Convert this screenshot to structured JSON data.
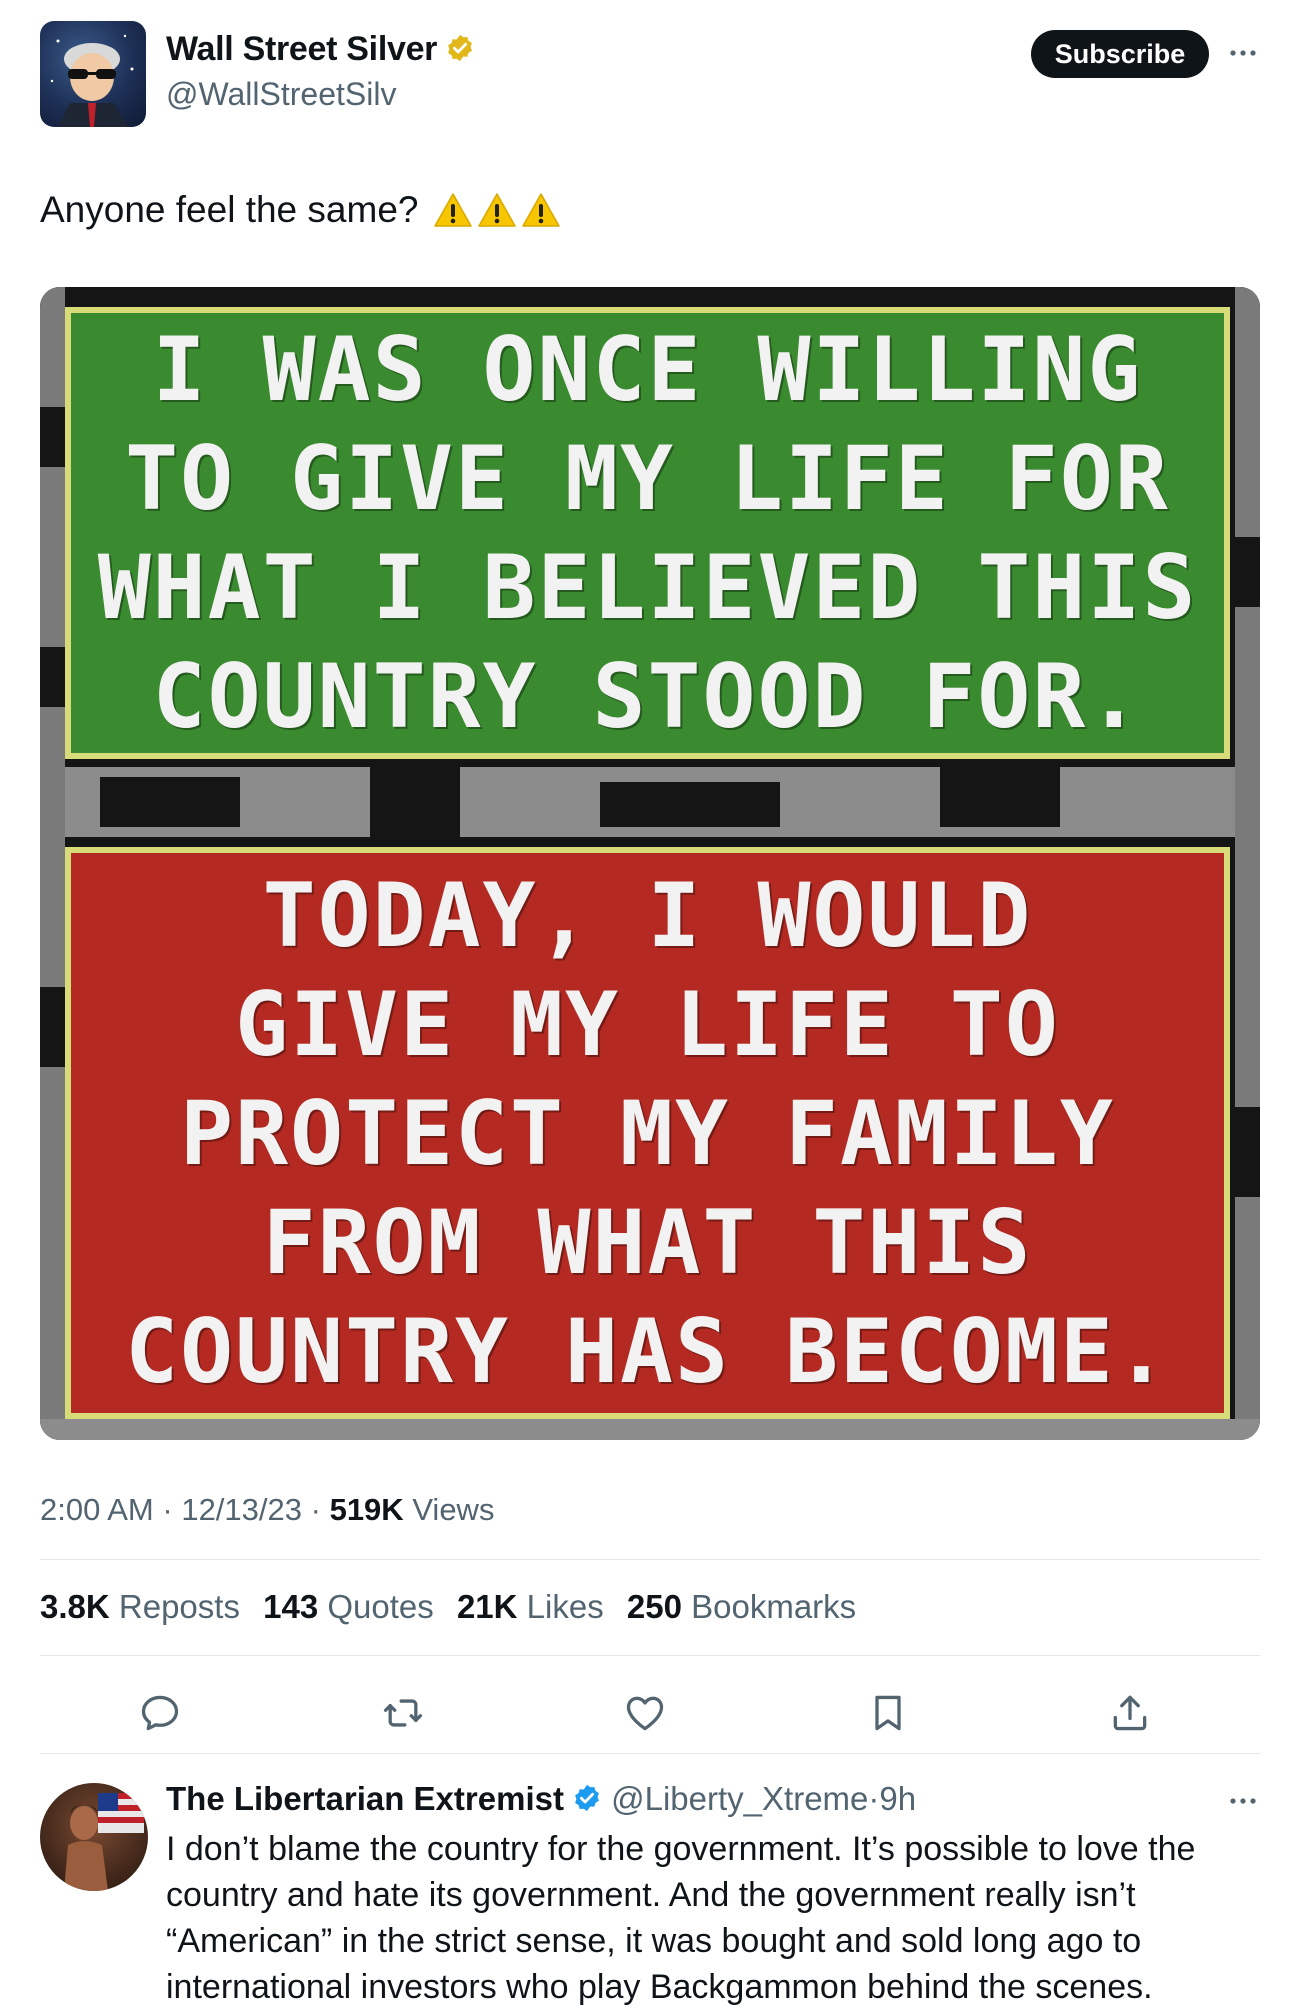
{
  "post": {
    "author_name": "Wall Street Silver",
    "author_handle": "@WallStreetSilv",
    "subscribe_label": "Subscribe",
    "text": "Anyone feel the same?",
    "emoji": [
      "⚠️",
      "⚠️",
      "⚠️"
    ],
    "media": {
      "green_sign_lines": [
        "I WAS ONCE WILLING",
        "TO GIVE MY LIFE FOR",
        "WHAT I BELIEVED THIS",
        "COUNTRY STOOD FOR."
      ],
      "red_sign_lines": [
        "TODAY, I WOULD",
        "GIVE MY LIFE TO",
        "PROTECT MY FAMILY",
        "FROM WHAT THIS",
        "COUNTRY HAS BECOME."
      ]
    },
    "time": "2:00 AM",
    "date": "12/13/23",
    "views_count": "519K",
    "views_label": "Views",
    "separator": "·"
  },
  "stats": {
    "reposts_count": "3.8K",
    "reposts_label": "Reposts",
    "quotes_count": "143",
    "quotes_label": "Quotes",
    "likes_count": "21K",
    "likes_label": "Likes",
    "bookmarks_count": "250",
    "bookmarks_label": "Bookmarks"
  },
  "actions": [
    "reply-icon",
    "repost-icon",
    "like-icon",
    "bookmark-icon",
    "share-icon"
  ],
  "reply": {
    "author_name": "The Libertarian Extremist",
    "author_handle": "@Liberty_Xtreme",
    "time": "9h",
    "separator": "·",
    "text": "I don’t blame the country for the government. It’s possible to love the country and hate its government. And the government really isn’t “American” in the strict sense, it was bought and sold long ago to international investors who play Backgammon behind the scenes."
  },
  "colors": {
    "verified_gold": "#e2b719",
    "verified_blue": "#1d9bf0",
    "sign_green": "#3a8a2f",
    "sign_red": "#b42a22",
    "sign_border": "#d7dc78"
  }
}
